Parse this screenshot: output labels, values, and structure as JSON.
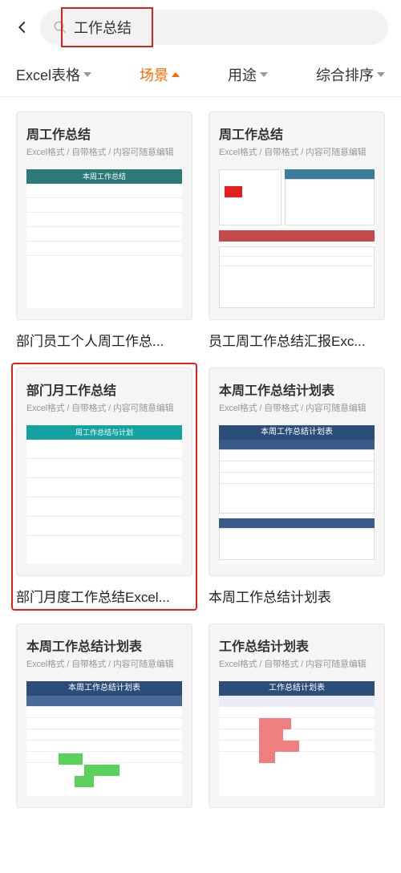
{
  "search": {
    "value": "工作总结"
  },
  "filters": {
    "items": [
      {
        "label": "Excel表格"
      },
      {
        "label": "场景"
      },
      {
        "label": "用途"
      },
      {
        "label": "综合排序"
      }
    ]
  },
  "templates": {
    "items": [
      {
        "thumbTitle": "周工作总结",
        "thumbSub": "Excel格式 / 自带格式 / 内容可随意编辑",
        "caption": "部门员工个人周工作总..."
      },
      {
        "thumbTitle": "周工作总结",
        "thumbSub": "Excel格式 / 自带格式 / 内容可随意编辑",
        "caption": "员工周工作总结汇报Exc..."
      },
      {
        "thumbTitle": "部门月工作总结",
        "thumbSub": "Excel格式 / 自带格式 / 内容可随意编辑",
        "caption": "部门月度工作总结Excel..."
      },
      {
        "thumbTitle": "本周工作总结计划表",
        "thumbSub": "Excel格式 / 自带格式 / 内容可随意编辑",
        "caption": "本周工作总结计划表"
      },
      {
        "thumbTitle": "本周工作总结计划表",
        "thumbSub": "Excel格式 / 自带格式 / 内容可随意编辑",
        "caption": ""
      },
      {
        "thumbTitle": "工作总结计划表",
        "thumbSub": "Excel格式 / 自带格式 / 内容可随意编辑",
        "caption": ""
      }
    ],
    "bar1": "本周工作总结",
    "bar3": "周工作总结与计划",
    "bar4": "本周工作总结计划表",
    "bar5": "本周工作总结计划表",
    "bar6": "工作总结计划表"
  }
}
